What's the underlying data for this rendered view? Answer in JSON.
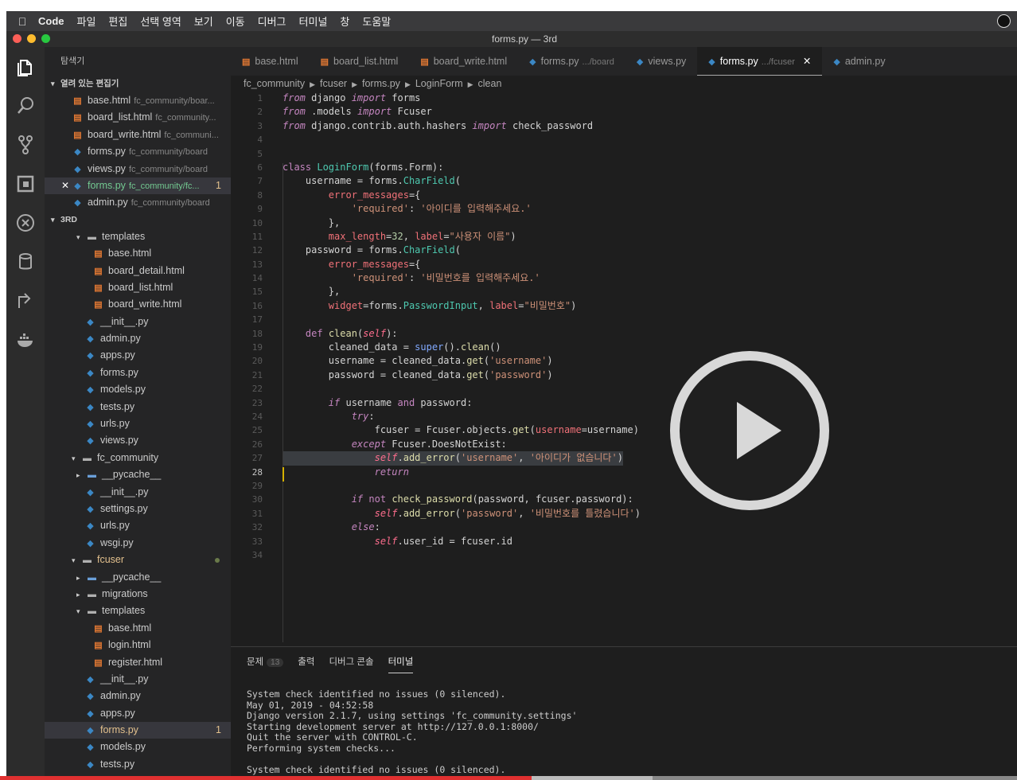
{
  "menubar": {
    "app": "Code",
    "items": [
      "파일",
      "편집",
      "선택 영역",
      "보기",
      "이동",
      "디버그",
      "터미널",
      "창",
      "도움말"
    ]
  },
  "window": {
    "title": "forms.py — 3rd"
  },
  "activity_icons": [
    "files-icon",
    "search-icon",
    "source-control-icon",
    "extensions-icon",
    "debug-icon",
    "database-icon",
    "remote-icon",
    "docker-icon"
  ],
  "sidebar": {
    "title": "탐색기",
    "open_editors_label": "열려 있는 편집기",
    "open_editors": [
      {
        "icon": "html",
        "name": "base.html",
        "desc": "fc_community/boar..."
      },
      {
        "icon": "html",
        "name": "board_list.html",
        "desc": "fc_community..."
      },
      {
        "icon": "html",
        "name": "board_write.html",
        "desc": "fc_communi..."
      },
      {
        "icon": "py",
        "name": "forms.py",
        "desc": "fc_community/board"
      },
      {
        "icon": "py",
        "name": "views.py",
        "desc": "fc_community/board"
      },
      {
        "icon": "py",
        "name": "forms.py",
        "desc": "fc_community/fc...",
        "badge": "1",
        "active": true,
        "close": "✕"
      },
      {
        "icon": "py",
        "name": "admin.py",
        "desc": "fc_community/board"
      }
    ],
    "project_label": "3RD",
    "tree": [
      {
        "depth": 1,
        "type": "folder",
        "open": true,
        "name": "templates"
      },
      {
        "depth": 2,
        "type": "html",
        "name": "base.html"
      },
      {
        "depth": 2,
        "type": "html",
        "name": "board_detail.html"
      },
      {
        "depth": 2,
        "type": "html",
        "name": "board_list.html"
      },
      {
        "depth": 2,
        "type": "html",
        "name": "board_write.html"
      },
      {
        "depth": 1.5,
        "type": "py",
        "name": "__init__.py"
      },
      {
        "depth": 1.5,
        "type": "py",
        "name": "admin.py"
      },
      {
        "depth": 1.5,
        "type": "py",
        "name": "apps.py"
      },
      {
        "depth": 1.5,
        "type": "py",
        "name": "forms.py"
      },
      {
        "depth": 1.5,
        "type": "py",
        "name": "models.py"
      },
      {
        "depth": 1.5,
        "type": "py",
        "name": "tests.py"
      },
      {
        "depth": 1.5,
        "type": "py",
        "name": "urls.py"
      },
      {
        "depth": 1.5,
        "type": "py",
        "name": "views.py"
      },
      {
        "depth": 0.7,
        "type": "folder",
        "open": true,
        "name": "fc_community"
      },
      {
        "depth": 1,
        "type": "folderb",
        "open": false,
        "name": "__pycache__"
      },
      {
        "depth": 1.5,
        "type": "py",
        "name": "__init__.py"
      },
      {
        "depth": 1.5,
        "type": "py",
        "name": "settings.py"
      },
      {
        "depth": 1.5,
        "type": "py",
        "name": "urls.py"
      },
      {
        "depth": 1.5,
        "type": "py",
        "name": "wsgi.py"
      },
      {
        "depth": 0.7,
        "type": "folder",
        "open": true,
        "name": "fcuser",
        "mod": true,
        "dot": true
      },
      {
        "depth": 1,
        "type": "folderb",
        "open": false,
        "name": "__pycache__"
      },
      {
        "depth": 1,
        "type": "folder",
        "open": false,
        "name": "migrations"
      },
      {
        "depth": 1,
        "type": "folder",
        "open": true,
        "name": "templates"
      },
      {
        "depth": 2,
        "type": "html",
        "name": "base.html"
      },
      {
        "depth": 2,
        "type": "html",
        "name": "login.html"
      },
      {
        "depth": 2,
        "type": "html",
        "name": "register.html"
      },
      {
        "depth": 1.5,
        "type": "py",
        "name": "__init__.py"
      },
      {
        "depth": 1.5,
        "type": "py",
        "name": "admin.py"
      },
      {
        "depth": 1.5,
        "type": "py",
        "name": "apps.py"
      },
      {
        "depth": 1.5,
        "type": "py",
        "name": "forms.py",
        "mod": true,
        "badge": "1",
        "active": true
      },
      {
        "depth": 1.5,
        "type": "py",
        "name": "models.py"
      },
      {
        "depth": 1.5,
        "type": "py",
        "name": "tests.py"
      }
    ]
  },
  "tabs": [
    {
      "icon": "html",
      "name": "base.html"
    },
    {
      "icon": "html",
      "name": "board_list.html"
    },
    {
      "icon": "html",
      "name": "board_write.html"
    },
    {
      "icon": "py",
      "name": "forms.py",
      "desc": ".../board"
    },
    {
      "icon": "py",
      "name": "views.py"
    },
    {
      "icon": "py",
      "name": "forms.py",
      "desc": ".../fcuser",
      "active": true,
      "close": "✕"
    },
    {
      "icon": "py",
      "name": "admin.py"
    }
  ],
  "breadcrumb": [
    "fc_community",
    "fcuser",
    "forms.py",
    "LoginForm",
    "clean"
  ],
  "code_lines": [
    [
      [
        "k",
        "from"
      ],
      [
        "t",
        " django "
      ],
      [
        "k",
        "import"
      ],
      [
        "t",
        " forms"
      ]
    ],
    [
      [
        "k",
        "from"
      ],
      [
        "t",
        " .models "
      ],
      [
        "k",
        "import"
      ],
      [
        "t",
        " Fcuser"
      ]
    ],
    [
      [
        "k",
        "from"
      ],
      [
        "t",
        " django.contrib.auth.hashers "
      ],
      [
        "k",
        "import"
      ],
      [
        "t",
        " check_password"
      ]
    ],
    [],
    [],
    [
      [
        "kw",
        "class"
      ],
      [
        "t",
        " "
      ],
      [
        "cls",
        "LoginForm"
      ],
      [
        "t",
        "(forms.Form):"
      ]
    ],
    [
      [
        "t",
        "    username = forms."
      ],
      [
        "cls",
        "CharField"
      ],
      [
        "t",
        "("
      ]
    ],
    [
      [
        "prm",
        "        error_messages"
      ],
      [
        "t",
        "={"
      ]
    ],
    [
      [
        "str",
        "            'required'"
      ],
      [
        "t",
        ": "
      ],
      [
        "str",
        "'아이디를 입력해주세요.'"
      ]
    ],
    [
      [
        "t",
        "        },"
      ]
    ],
    [
      [
        "prm",
        "        max_length"
      ],
      [
        "t",
        "="
      ],
      [
        "num",
        "32"
      ],
      [
        "t",
        ", "
      ],
      [
        "prm",
        "label"
      ],
      [
        "t",
        "="
      ],
      [
        "str",
        "\"사용자 이름\""
      ],
      [
        "t",
        ")"
      ]
    ],
    [
      [
        "t",
        "    password = forms."
      ],
      [
        "cls",
        "CharField"
      ],
      [
        "t",
        "("
      ]
    ],
    [
      [
        "prm",
        "        error_messages"
      ],
      [
        "t",
        "={"
      ]
    ],
    [
      [
        "str",
        "            'required'"
      ],
      [
        "t",
        ": "
      ],
      [
        "str",
        "'비밀번호를 입력해주세요.'"
      ]
    ],
    [
      [
        "t",
        "        },"
      ]
    ],
    [
      [
        "prm",
        "        widget"
      ],
      [
        "t",
        "=forms."
      ],
      [
        "cls",
        "PasswordInput"
      ],
      [
        "t",
        ", "
      ],
      [
        "prm",
        "label"
      ],
      [
        "t",
        "="
      ],
      [
        "str",
        "\"비밀번호\""
      ],
      [
        "t",
        ")"
      ]
    ],
    [],
    [
      [
        "kw",
        "    def"
      ],
      [
        "t",
        " "
      ],
      [
        "fn",
        "clean"
      ],
      [
        "t",
        "("
      ],
      [
        "self",
        "self"
      ],
      [
        "t",
        "):"
      ]
    ],
    [
      [
        "t",
        "        cleaned_data = "
      ],
      [
        "bl",
        "super"
      ],
      [
        "t",
        "()."
      ],
      [
        "fn",
        "clean"
      ],
      [
        "t",
        "()"
      ]
    ],
    [
      [
        "t",
        "        username = cleaned_data."
      ],
      [
        "fn",
        "get"
      ],
      [
        "t",
        "("
      ],
      [
        "str",
        "'username'"
      ],
      [
        "t",
        ")"
      ]
    ],
    [
      [
        "t",
        "        password = cleaned_data."
      ],
      [
        "fn",
        "get"
      ],
      [
        "t",
        "("
      ],
      [
        "str",
        "'password'"
      ],
      [
        "t",
        ")"
      ]
    ],
    [],
    [
      [
        "k",
        "        if"
      ],
      [
        "t",
        " username "
      ],
      [
        "kw",
        "and"
      ],
      [
        "t",
        " password:"
      ]
    ],
    [
      [
        "k",
        "            try"
      ],
      [
        "t",
        ":"
      ]
    ],
    [
      [
        "t",
        "                fcuser = Fcuser.objects."
      ],
      [
        "fn",
        "get"
      ],
      [
        "t",
        "("
      ],
      [
        "prm",
        "username"
      ],
      [
        "t",
        "=username)"
      ]
    ],
    [
      [
        "k",
        "            except"
      ],
      [
        "t",
        " Fcuser.DoesNotExist:"
      ]
    ],
    [
      [
        "self",
        "                self"
      ],
      [
        "t",
        "."
      ],
      [
        "fn",
        "add_error"
      ],
      [
        "t",
        "("
      ],
      [
        "str",
        "'username'"
      ],
      [
        "t",
        ", "
      ],
      [
        "str",
        "'아이디가 없습니다'"
      ],
      [
        "t",
        ")"
      ]
    ],
    [
      [
        "k",
        "                return"
      ]
    ],
    [],
    [
      [
        "k",
        "            if"
      ],
      [
        "t",
        " "
      ],
      [
        "kw",
        "not"
      ],
      [
        "t",
        " "
      ],
      [
        "fn",
        "check_password"
      ],
      [
        "t",
        "(password, fcuser.password):"
      ]
    ],
    [
      [
        "self",
        "                self"
      ],
      [
        "t",
        "."
      ],
      [
        "fn",
        "add_error"
      ],
      [
        "t",
        "("
      ],
      [
        "str",
        "'password'"
      ],
      [
        "t",
        ", "
      ],
      [
        "str",
        "'비밀번호를 틀렸습니다'"
      ],
      [
        "t",
        ")"
      ]
    ],
    [
      [
        "k",
        "            else"
      ],
      [
        "t",
        ":"
      ]
    ],
    [
      [
        "self",
        "                self"
      ],
      [
        "t",
        ".user_id = fcuser.id"
      ]
    ],
    []
  ],
  "panel": {
    "tabs": [
      {
        "label": "문제",
        "count": "13"
      },
      {
        "label": "출력"
      },
      {
        "label": "디버그 콘솔"
      },
      {
        "label": "터미널",
        "active": true
      }
    ],
    "terminal": [
      "System check identified no issues (0 silenced).",
      "May 01, 2019 - 04:52:58",
      "Django version 2.1.7, using settings 'fc_community.settings'",
      "Starting development server at http://127.0.0.1:8000/",
      "Quit the server with CONTROL-C.",
      "Performing system checks...",
      "",
      "System check identified no issues (0 silenced)."
    ]
  },
  "video": {
    "progress": 0.523
  }
}
